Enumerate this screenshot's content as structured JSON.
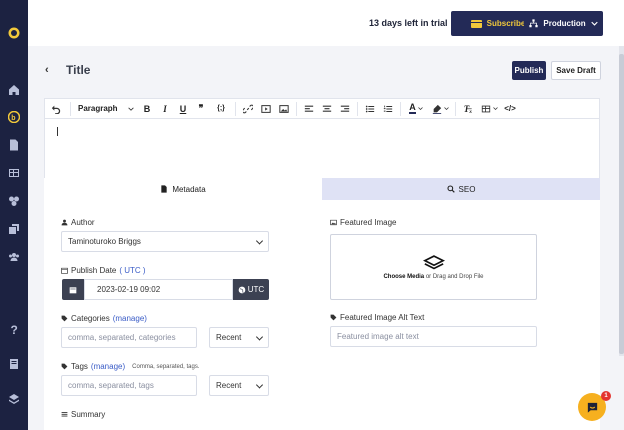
{
  "sidebar": {
    "items": [
      {
        "icon": "logo-icon"
      },
      {
        "icon": "home-icon"
      },
      {
        "icon": "blog-icon"
      },
      {
        "icon": "document-icon"
      },
      {
        "icon": "table-icon"
      },
      {
        "icon": "integrations-icon"
      },
      {
        "icon": "copy-icon"
      },
      {
        "icon": "users-icon"
      },
      {
        "icon": "help-icon"
      },
      {
        "icon": "book-icon"
      },
      {
        "icon": "layers-icon"
      }
    ]
  },
  "topbar": {
    "trial_text": "13 days left in trial",
    "subscribe_label": "Subscribe",
    "environment_label": "Production"
  },
  "header": {
    "back": "‹",
    "title": "Title",
    "publish_label": "Publish",
    "save_draft_label": "Save Draft"
  },
  "editor": {
    "paragraph_label": "Paragraph"
  },
  "tabs": [
    {
      "label": "Metadata",
      "active": true
    },
    {
      "label": "SEO",
      "active": false
    }
  ],
  "metadata": {
    "author_label": "Author",
    "author_value": "Taminoturoko Briggs",
    "publish_date_label": "Publish Date",
    "publish_date_tz": "( UTC )",
    "publish_date_value": "2023-02-19 09:02",
    "utc_button": "UTC",
    "categories_label": "Categories",
    "categories_manage": "(manage)",
    "categories_placeholder": "comma, separated, categories",
    "categories_sort": "Recent",
    "tags_label": "Tags",
    "tags_manage": "(manage)",
    "tags_hint": "Comma, separated, tags.",
    "tags_placeholder": "comma, separated, tags",
    "tags_sort": "Recent",
    "summary_label": "Summary",
    "featured_image_label": "Featured Image",
    "choose_media": "Choose Media",
    "drop_text": "or Drag and Drop File",
    "alt_text_label": "Featured Image Alt Text",
    "alt_text_placeholder": "Featured image alt text"
  },
  "chat": {
    "badge": "1"
  },
  "colors": {
    "accent": "#232a57",
    "subscribe": "#f2c93b",
    "chat": "#f6b01f",
    "sidebar": "#1c2241"
  }
}
